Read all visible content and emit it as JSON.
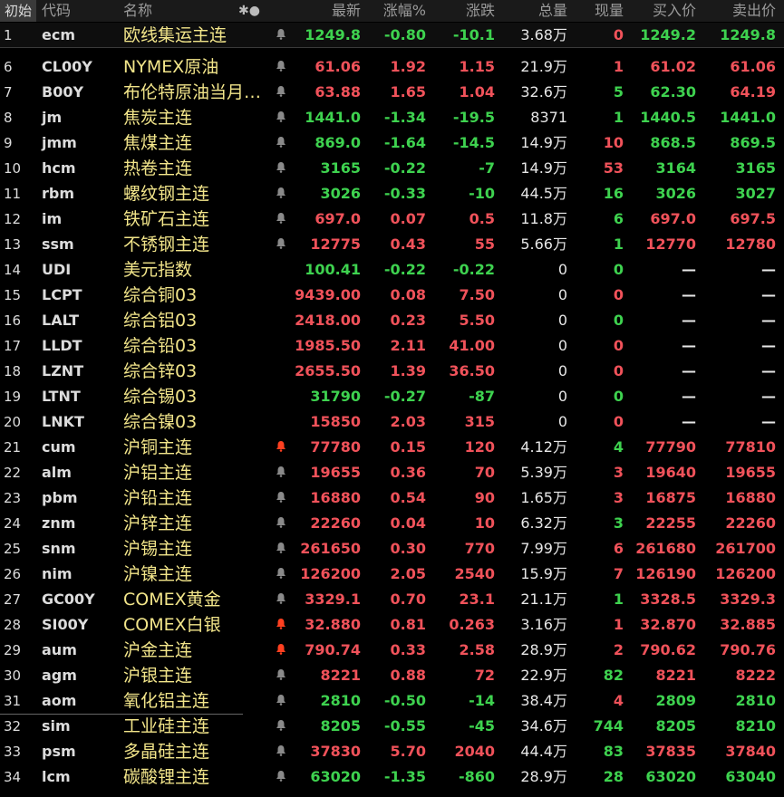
{
  "header": {
    "idx": "初始",
    "code": "代码",
    "name": "名称",
    "flag": "✱●",
    "last": "最新",
    "pct": "涨幅%",
    "chg": "涨跌",
    "vol": "总量",
    "cur": "现量",
    "bid": "买入价",
    "ask": "卖出价"
  },
  "colors": {
    "up": "#f0525a",
    "down": "#3ed24f",
    "name": "#f2e58a",
    "bell_gray": "#8a8a8a",
    "bell_red": "#ff4020"
  },
  "rows": [
    {
      "idx": "1",
      "code": "ecm",
      "name": "欧线集运主连",
      "bell": "gray",
      "last": "1249.8",
      "pct": "-0.80",
      "chg": "-10.1",
      "vol": "3.68万",
      "cur": "0",
      "bid": "1249.2",
      "ask": "1249.8",
      "dir": "dn",
      "cur_dir": "up",
      "bid_dir": "dn",
      "ask_dir": "dn"
    },
    {
      "idx": "6",
      "code": "CL00Y",
      "name": "NYMEX原油",
      "bell": "gray",
      "last": "61.06",
      "pct": "1.92",
      "chg": "1.15",
      "vol": "21.9万",
      "cur": "1",
      "bid": "61.02",
      "ask": "61.06",
      "dir": "up",
      "cur_dir": "up",
      "bid_dir": "up",
      "ask_dir": "up"
    },
    {
      "idx": "7",
      "code": "B00Y",
      "name": "布伦特原油当月连续",
      "bell": "gray",
      "last": "63.88",
      "pct": "1.65",
      "chg": "1.04",
      "vol": "32.6万",
      "cur": "5",
      "bid": "62.30",
      "ask": "64.19",
      "dir": "up",
      "cur_dir": "dn",
      "bid_dir": "dn",
      "ask_dir": "up"
    },
    {
      "idx": "8",
      "code": "jm",
      "name": "焦炭主连",
      "bell": "gray",
      "last": "1441.0",
      "pct": "-1.34",
      "chg": "-19.5",
      "vol": "8371",
      "cur": "1",
      "bid": "1440.5",
      "ask": "1441.0",
      "dir": "dn",
      "cur_dir": "dn",
      "bid_dir": "dn",
      "ask_dir": "dn"
    },
    {
      "idx": "9",
      "code": "jmm",
      "name": "焦煤主连",
      "bell": "gray",
      "last": "869.0",
      "pct": "-1.64",
      "chg": "-14.5",
      "vol": "14.9万",
      "cur": "10",
      "bid": "868.5",
      "ask": "869.5",
      "dir": "dn",
      "cur_dir": "up",
      "bid_dir": "dn",
      "ask_dir": "dn"
    },
    {
      "idx": "10",
      "code": "hcm",
      "name": "热卷主连",
      "bell": "gray",
      "last": "3165",
      "pct": "-0.22",
      "chg": "-7",
      "vol": "14.9万",
      "cur": "53",
      "bid": "3164",
      "ask": "3165",
      "dir": "dn",
      "cur_dir": "up",
      "bid_dir": "dn",
      "ask_dir": "dn"
    },
    {
      "idx": "11",
      "code": "rbm",
      "name": "螺纹钢主连",
      "bell": "gray",
      "last": "3026",
      "pct": "-0.33",
      "chg": "-10",
      "vol": "44.5万",
      "cur": "16",
      "bid": "3026",
      "ask": "3027",
      "dir": "dn",
      "cur_dir": "dn",
      "bid_dir": "dn",
      "ask_dir": "dn"
    },
    {
      "idx": "12",
      "code": "im",
      "name": "铁矿石主连",
      "bell": "gray",
      "last": "697.0",
      "pct": "0.07",
      "chg": "0.5",
      "vol": "11.8万",
      "cur": "6",
      "bid": "697.0",
      "ask": "697.5",
      "dir": "up",
      "cur_dir": "dn",
      "bid_dir": "up",
      "ask_dir": "up"
    },
    {
      "idx": "13",
      "code": "ssm",
      "name": "不锈钢主连",
      "bell": "gray",
      "last": "12775",
      "pct": "0.43",
      "chg": "55",
      "vol": "5.66万",
      "cur": "1",
      "bid": "12770",
      "ask": "12780",
      "dir": "up",
      "cur_dir": "dn",
      "bid_dir": "up",
      "ask_dir": "up"
    },
    {
      "idx": "14",
      "code": "UDI",
      "name": "美元指数",
      "bell": "",
      "last": "100.41",
      "pct": "-0.22",
      "chg": "-0.22",
      "vol": "0",
      "cur": "0",
      "bid": "—",
      "ask": "—",
      "dir": "dn",
      "cur_dir": "dn",
      "bid_dir": "flat",
      "ask_dir": "flat"
    },
    {
      "idx": "15",
      "code": "LCPT",
      "name": "综合铜03",
      "bell": "",
      "last": "9439.00",
      "pct": "0.08",
      "chg": "7.50",
      "vol": "0",
      "cur": "0",
      "bid": "—",
      "ask": "—",
      "dir": "up",
      "cur_dir": "up",
      "bid_dir": "flat",
      "ask_dir": "flat"
    },
    {
      "idx": "16",
      "code": "LALT",
      "name": "综合铝03",
      "bell": "",
      "last": "2418.00",
      "pct": "0.23",
      "chg": "5.50",
      "vol": "0",
      "cur": "0",
      "bid": "—",
      "ask": "—",
      "dir": "up",
      "cur_dir": "dn",
      "bid_dir": "flat",
      "ask_dir": "flat"
    },
    {
      "idx": "17",
      "code": "LLDT",
      "name": "综合铅03",
      "bell": "",
      "last": "1985.50",
      "pct": "2.11",
      "chg": "41.00",
      "vol": "0",
      "cur": "0",
      "bid": "—",
      "ask": "—",
      "dir": "up",
      "cur_dir": "up",
      "bid_dir": "flat",
      "ask_dir": "flat"
    },
    {
      "idx": "18",
      "code": "LZNT",
      "name": "综合锌03",
      "bell": "",
      "last": "2655.50",
      "pct": "1.39",
      "chg": "36.50",
      "vol": "0",
      "cur": "0",
      "bid": "—",
      "ask": "—",
      "dir": "up",
      "cur_dir": "up",
      "bid_dir": "flat",
      "ask_dir": "flat"
    },
    {
      "idx": "19",
      "code": "LTNT",
      "name": "综合锡03",
      "bell": "",
      "last": "31790",
      "pct": "-0.27",
      "chg": "-87",
      "vol": "0",
      "cur": "0",
      "bid": "—",
      "ask": "—",
      "dir": "dn",
      "cur_dir": "dn",
      "bid_dir": "flat",
      "ask_dir": "flat"
    },
    {
      "idx": "20",
      "code": "LNKT",
      "name": "综合镍03",
      "bell": "",
      "last": "15850",
      "pct": "2.03",
      "chg": "315",
      "vol": "0",
      "cur": "0",
      "bid": "—",
      "ask": "—",
      "dir": "up",
      "cur_dir": "up",
      "bid_dir": "flat",
      "ask_dir": "flat"
    },
    {
      "idx": "21",
      "code": "cum",
      "name": "沪铜主连",
      "bell": "red",
      "last": "77780",
      "pct": "0.15",
      "chg": "120",
      "vol": "4.12万",
      "cur": "4",
      "bid": "77790",
      "ask": "77810",
      "dir": "up",
      "cur_dir": "dn",
      "bid_dir": "up",
      "ask_dir": "up"
    },
    {
      "idx": "22",
      "code": "alm",
      "name": "沪铝主连",
      "bell": "gray",
      "last": "19655",
      "pct": "0.36",
      "chg": "70",
      "vol": "5.39万",
      "cur": "3",
      "bid": "19640",
      "ask": "19655",
      "dir": "up",
      "cur_dir": "up",
      "bid_dir": "up",
      "ask_dir": "up"
    },
    {
      "idx": "23",
      "code": "pbm",
      "name": "沪铅主连",
      "bell": "gray",
      "last": "16880",
      "pct": "0.54",
      "chg": "90",
      "vol": "1.65万",
      "cur": "3",
      "bid": "16875",
      "ask": "16880",
      "dir": "up",
      "cur_dir": "up",
      "bid_dir": "up",
      "ask_dir": "up"
    },
    {
      "idx": "24",
      "code": "znm",
      "name": "沪锌主连",
      "bell": "gray",
      "last": "22260",
      "pct": "0.04",
      "chg": "10",
      "vol": "6.32万",
      "cur": "3",
      "bid": "22255",
      "ask": "22260",
      "dir": "up",
      "cur_dir": "dn",
      "bid_dir": "up",
      "ask_dir": "up"
    },
    {
      "idx": "25",
      "code": "snm",
      "name": "沪锡主连",
      "bell": "gray",
      "last": "261650",
      "pct": "0.30",
      "chg": "770",
      "vol": "7.99万",
      "cur": "6",
      "bid": "261680",
      "ask": "261700",
      "dir": "up",
      "cur_dir": "up",
      "bid_dir": "up",
      "ask_dir": "up"
    },
    {
      "idx": "26",
      "code": "nim",
      "name": "沪镍主连",
      "bell": "gray",
      "last": "126200",
      "pct": "2.05",
      "chg": "2540",
      "vol": "15.9万",
      "cur": "7",
      "bid": "126190",
      "ask": "126200",
      "dir": "up",
      "cur_dir": "up",
      "bid_dir": "up",
      "ask_dir": "up"
    },
    {
      "idx": "27",
      "code": "GC00Y",
      "name": "COMEX黄金",
      "bell": "gray",
      "last": "3329.1",
      "pct": "0.70",
      "chg": "23.1",
      "vol": "21.1万",
      "cur": "1",
      "bid": "3328.5",
      "ask": "3329.3",
      "dir": "up",
      "cur_dir": "dn",
      "bid_dir": "up",
      "ask_dir": "up"
    },
    {
      "idx": "28",
      "code": "SI00Y",
      "name": "COMEX白银",
      "bell": "red",
      "last": "32.880",
      "pct": "0.81",
      "chg": "0.263",
      "vol": "3.16万",
      "cur": "1",
      "bid": "32.870",
      "ask": "32.885",
      "dir": "up",
      "cur_dir": "up",
      "bid_dir": "up",
      "ask_dir": "up"
    },
    {
      "idx": "29",
      "code": "aum",
      "name": "沪金主连",
      "bell": "red",
      "last": "790.74",
      "pct": "0.33",
      "chg": "2.58",
      "vol": "28.9万",
      "cur": "2",
      "bid": "790.62",
      "ask": "790.76",
      "dir": "up",
      "cur_dir": "up",
      "bid_dir": "up",
      "ask_dir": "up"
    },
    {
      "idx": "30",
      "code": "agm",
      "name": "沪银主连",
      "bell": "gray",
      "last": "8221",
      "pct": "0.88",
      "chg": "72",
      "vol": "22.9万",
      "cur": "82",
      "bid": "8221",
      "ask": "8222",
      "dir": "up",
      "cur_dir": "dn",
      "bid_dir": "up",
      "ask_dir": "up"
    },
    {
      "idx": "31",
      "code": "aom",
      "name": "氧化铝主连",
      "bell": "gray",
      "last": "2810",
      "pct": "-0.50",
      "chg": "-14",
      "vol": "38.4万",
      "cur": "4",
      "bid": "2809",
      "ask": "2810",
      "dir": "dn",
      "cur_dir": "up",
      "bid_dir": "dn",
      "ask_dir": "dn"
    },
    {
      "idx": "32",
      "code": "sim",
      "name": "工业硅主连",
      "bell": "gray",
      "last": "8205",
      "pct": "-0.55",
      "chg": "-45",
      "vol": "34.6万",
      "cur": "744",
      "bid": "8205",
      "ask": "8210",
      "dir": "dn",
      "cur_dir": "dn",
      "bid_dir": "dn",
      "ask_dir": "dn"
    },
    {
      "idx": "33",
      "code": "psm",
      "name": "多晶硅主连",
      "bell": "gray",
      "last": "37830",
      "pct": "5.70",
      "chg": "2040",
      "vol": "44.4万",
      "cur": "83",
      "bid": "37835",
      "ask": "37840",
      "dir": "up",
      "cur_dir": "dn",
      "bid_dir": "up",
      "ask_dir": "up"
    },
    {
      "idx": "34",
      "code": "lcm",
      "name": "碳酸锂主连",
      "bell": "gray",
      "last": "63020",
      "pct": "-1.35",
      "chg": "-860",
      "vol": "28.9万",
      "cur": "28",
      "bid": "63020",
      "ask": "63040",
      "dir": "dn",
      "cur_dir": "dn",
      "bid_dir": "dn",
      "ask_dir": "dn"
    }
  ]
}
